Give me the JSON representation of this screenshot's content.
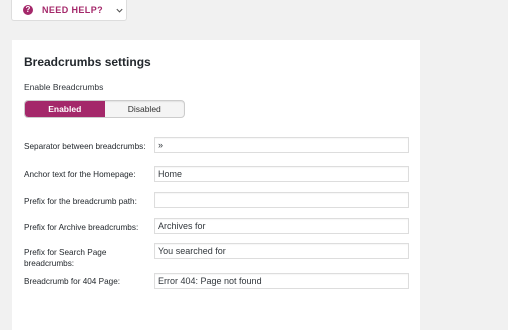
{
  "help": {
    "label": "NEED HELP?",
    "icon": "question-icon",
    "chevron_icon": "chevron-down-icon"
  },
  "colors": {
    "accent": "#a4286a",
    "background": "#f1f1f1",
    "panel": "#ffffff"
  },
  "settings": {
    "title": "Breadcrumbs settings",
    "enable_label": "Enable Breadcrumbs",
    "toggle": {
      "enabled_label": "Enabled",
      "disabled_label": "Disabled",
      "selected": "Enabled"
    },
    "fields": [
      {
        "label": "Separator between breadcrumbs:",
        "value": "»",
        "placeholder": ""
      },
      {
        "label": "Anchor text for the Homepage:",
        "value": "Home",
        "placeholder": ""
      },
      {
        "label": "Prefix for the breadcrumb path:",
        "value": "",
        "placeholder": ""
      },
      {
        "label": "Prefix for Archive breadcrumbs:",
        "value": "Archives for",
        "placeholder": ""
      },
      {
        "label": "Prefix for Search Page breadcrumbs:",
        "value": "You searched for",
        "placeholder": ""
      },
      {
        "label": "Breadcrumb for 404 Page:",
        "value": "Error 404: Page not found",
        "placeholder": ""
      }
    ]
  }
}
